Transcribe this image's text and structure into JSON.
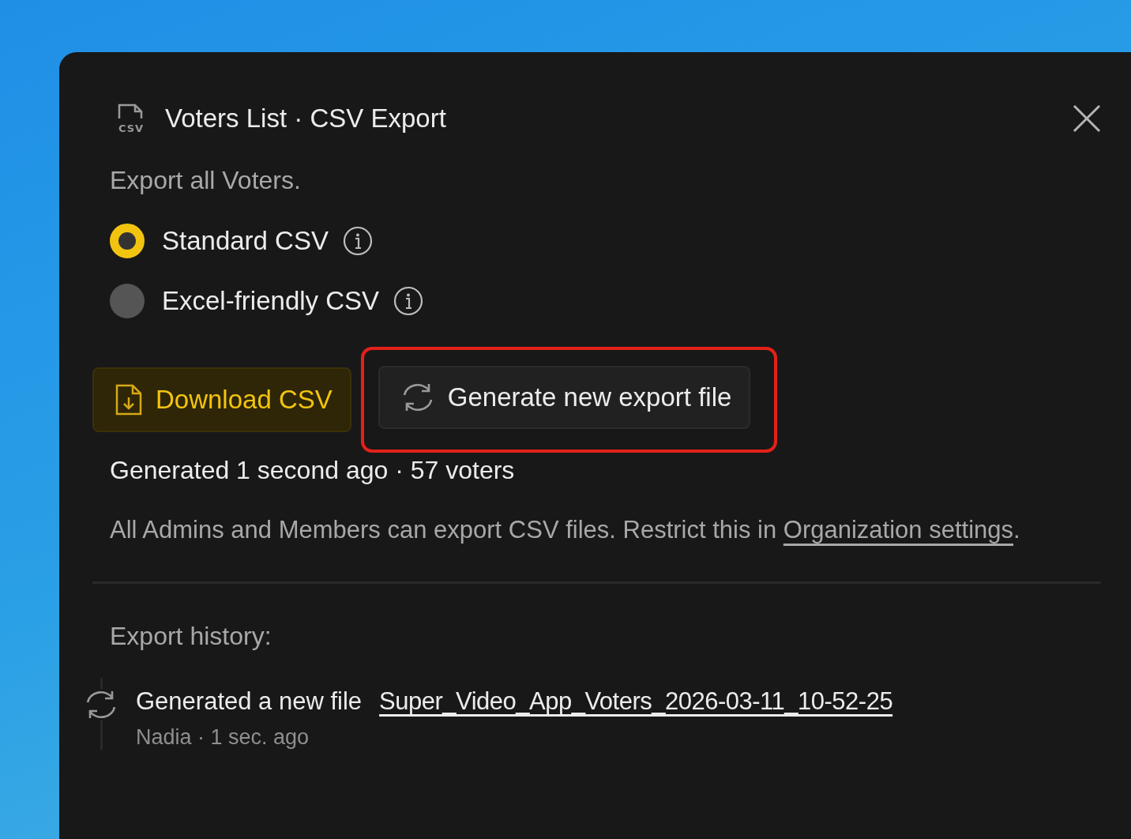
{
  "dialog": {
    "icon_label": "CSV",
    "title": "Voters List · CSV Export",
    "description": "Export all Voters.",
    "formats": [
      {
        "label": "Standard CSV",
        "selected": true
      },
      {
        "label": "Excel-friendly CSV",
        "selected": false
      }
    ],
    "buttons": [
      {
        "kind": "download",
        "label": "Download CSV",
        "highlighted": false
      },
      {
        "kind": "generate",
        "label": "Generate new export file",
        "highlighted": true
      }
    ],
    "status": "Generated 1 second ago · 57 voters",
    "permission_note": {
      "text": "All Admins and Members can export CSV files. Restrict this in",
      "link": "Organization settings",
      "end": "."
    },
    "history_heading": "Export history:",
    "history": [
      {
        "action": "Generated a new file",
        "file": "Super_Video_App_Voters_2026-03-11_10-52-25",
        "meta": "Nadia · 1 sec. ago"
      }
    ]
  }
}
